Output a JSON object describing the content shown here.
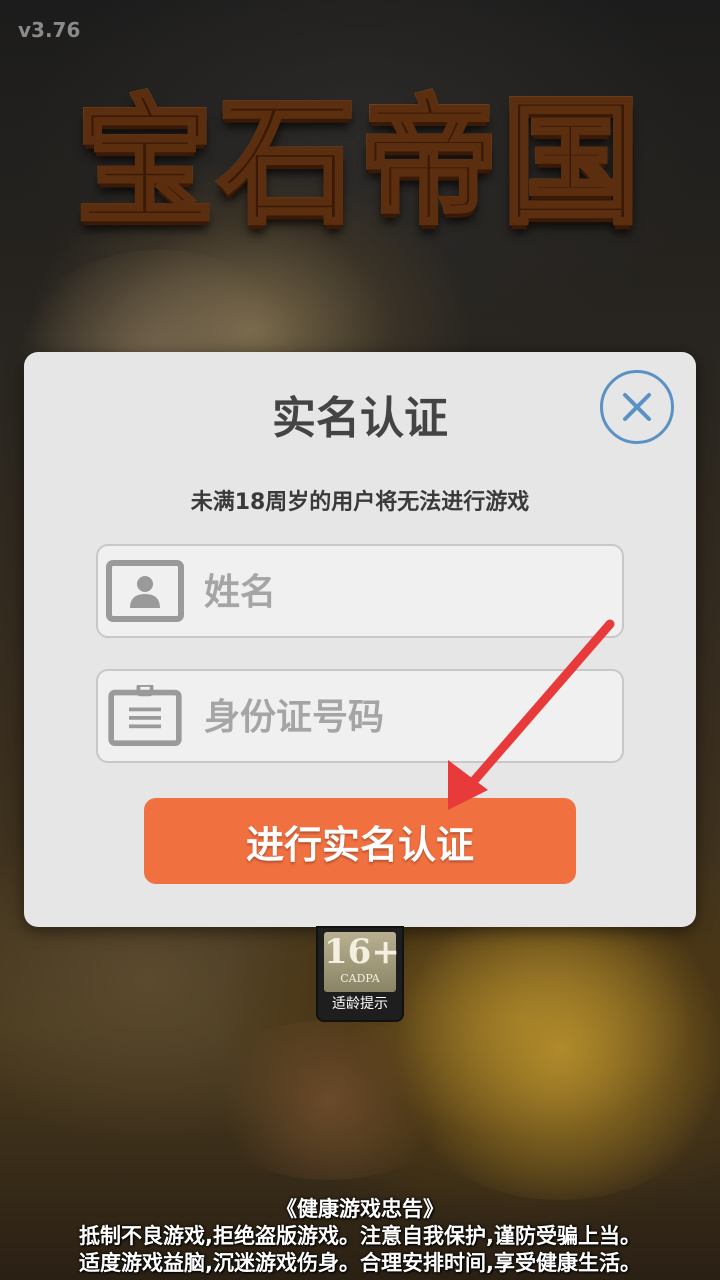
{
  "version": "v3.76",
  "logo_text": "宝石帝国",
  "dialog": {
    "title": "实名认证",
    "subtitle": "未满18周岁的用户将无法进行游戏",
    "name_placeholder": "姓名",
    "id_placeholder": "身份证号码",
    "submit_label": "进行实名认证",
    "close_icon": "close-icon"
  },
  "age_badge": {
    "rating": "16+",
    "org": "CADPA",
    "tip": "适龄提示"
  },
  "health_notice": {
    "title": "《健康游戏忠告》",
    "line1": "抵制不良游戏,拒绝盗版游戏。注意自我保护,谨防受骗上当。",
    "line2": "适度游戏益脑,沉迷游戏伤身。合理安排时间,享受健康生活。"
  },
  "colors": {
    "submit_button": "#f07040",
    "close_ring": "#5b92c5",
    "arrow": "#e83a3a"
  }
}
